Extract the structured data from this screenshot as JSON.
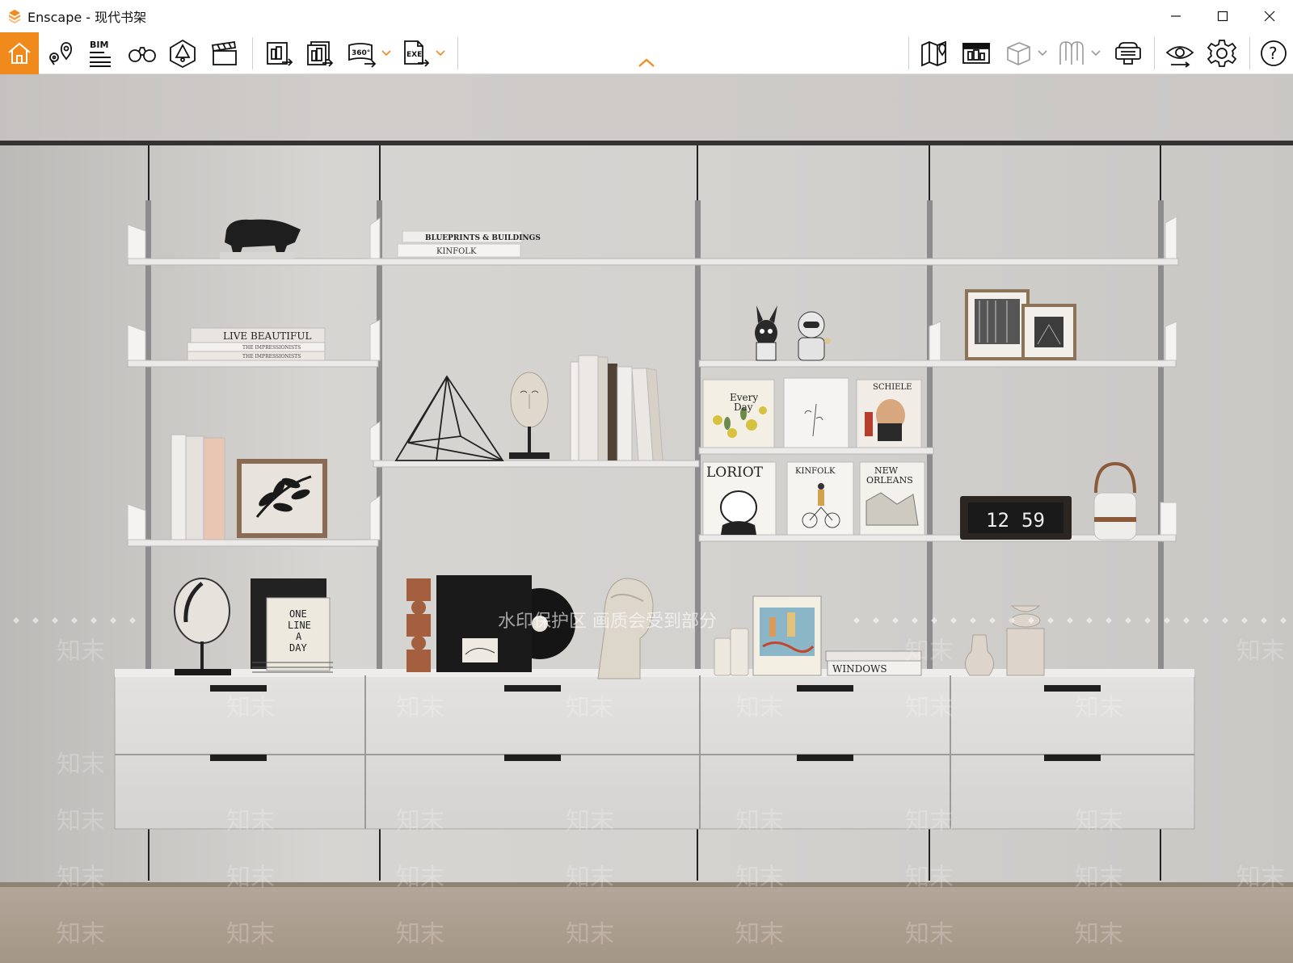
{
  "window": {
    "app_name": "Enscape",
    "title": "Enscape - 现代书架",
    "controls": {
      "minimize": "minimize",
      "maximize": "maximize",
      "close": "close"
    }
  },
  "toolbar": {
    "accent_color": "#f08a1c",
    "bim_label": "BIM",
    "left_tools": [
      {
        "name": "home",
        "icon": "home-icon"
      },
      {
        "name": "views",
        "icon": "location-pins-icon"
      },
      {
        "name": "bim",
        "icon": "bim-lines-icon"
      },
      {
        "name": "binoculars",
        "icon": "binoculars-icon"
      },
      {
        "name": "asset-library",
        "icon": "asset-library-icon"
      },
      {
        "name": "video-editor",
        "icon": "clapperboard-icon"
      }
    ],
    "export_tools": [
      {
        "name": "screenshot",
        "icon": "screenshot-export-icon"
      },
      {
        "name": "batch-render",
        "icon": "batch-render-icon"
      },
      {
        "name": "panorama",
        "icon": "panorama-360-icon",
        "label": "360°"
      },
      {
        "name": "exe-export",
        "icon": "exe-export-icon",
        "label": "EXE"
      }
    ],
    "right_tools": [
      {
        "name": "map",
        "icon": "map-icon"
      },
      {
        "name": "views-manager",
        "icon": "views-manager-icon"
      },
      {
        "name": "cube",
        "icon": "cube-icon"
      },
      {
        "name": "orthographic",
        "icon": "orthographic-icon"
      },
      {
        "name": "vr",
        "icon": "vr-headset-icon"
      },
      {
        "name": "visual-settings",
        "icon": "eye-icon"
      },
      {
        "name": "settings",
        "icon": "gear-icon"
      },
      {
        "name": "help",
        "icon": "help-icon",
        "label": "?"
      }
    ]
  },
  "scene": {
    "books": {
      "blueprints": "BLUEPRINTS & BUILDINGS",
      "kinfolk_table": "KINFOLK",
      "live_beautiful": "LIVE BEAUTIFUL",
      "impressionists": "THE IMPRESSIONISTS",
      "every_day_1": "Every",
      "every_day_2": "Day",
      "schiele": "SCHIELE",
      "loriot": "LORIOT",
      "kinfolk": "KINFOLK",
      "new_orleans_1": "NEW",
      "new_orleans_2": "ORLEANS",
      "one_line_1": "ONE",
      "one_line_2": "LINE",
      "one_line_3": "A",
      "one_line_4": "DAY",
      "windows": "WINDOWS"
    },
    "clock": {
      "hour": "12",
      "minute": "59"
    },
    "watermark": {
      "banner": "水印保护区 画质会受到部分",
      "repeat": "知末"
    }
  }
}
